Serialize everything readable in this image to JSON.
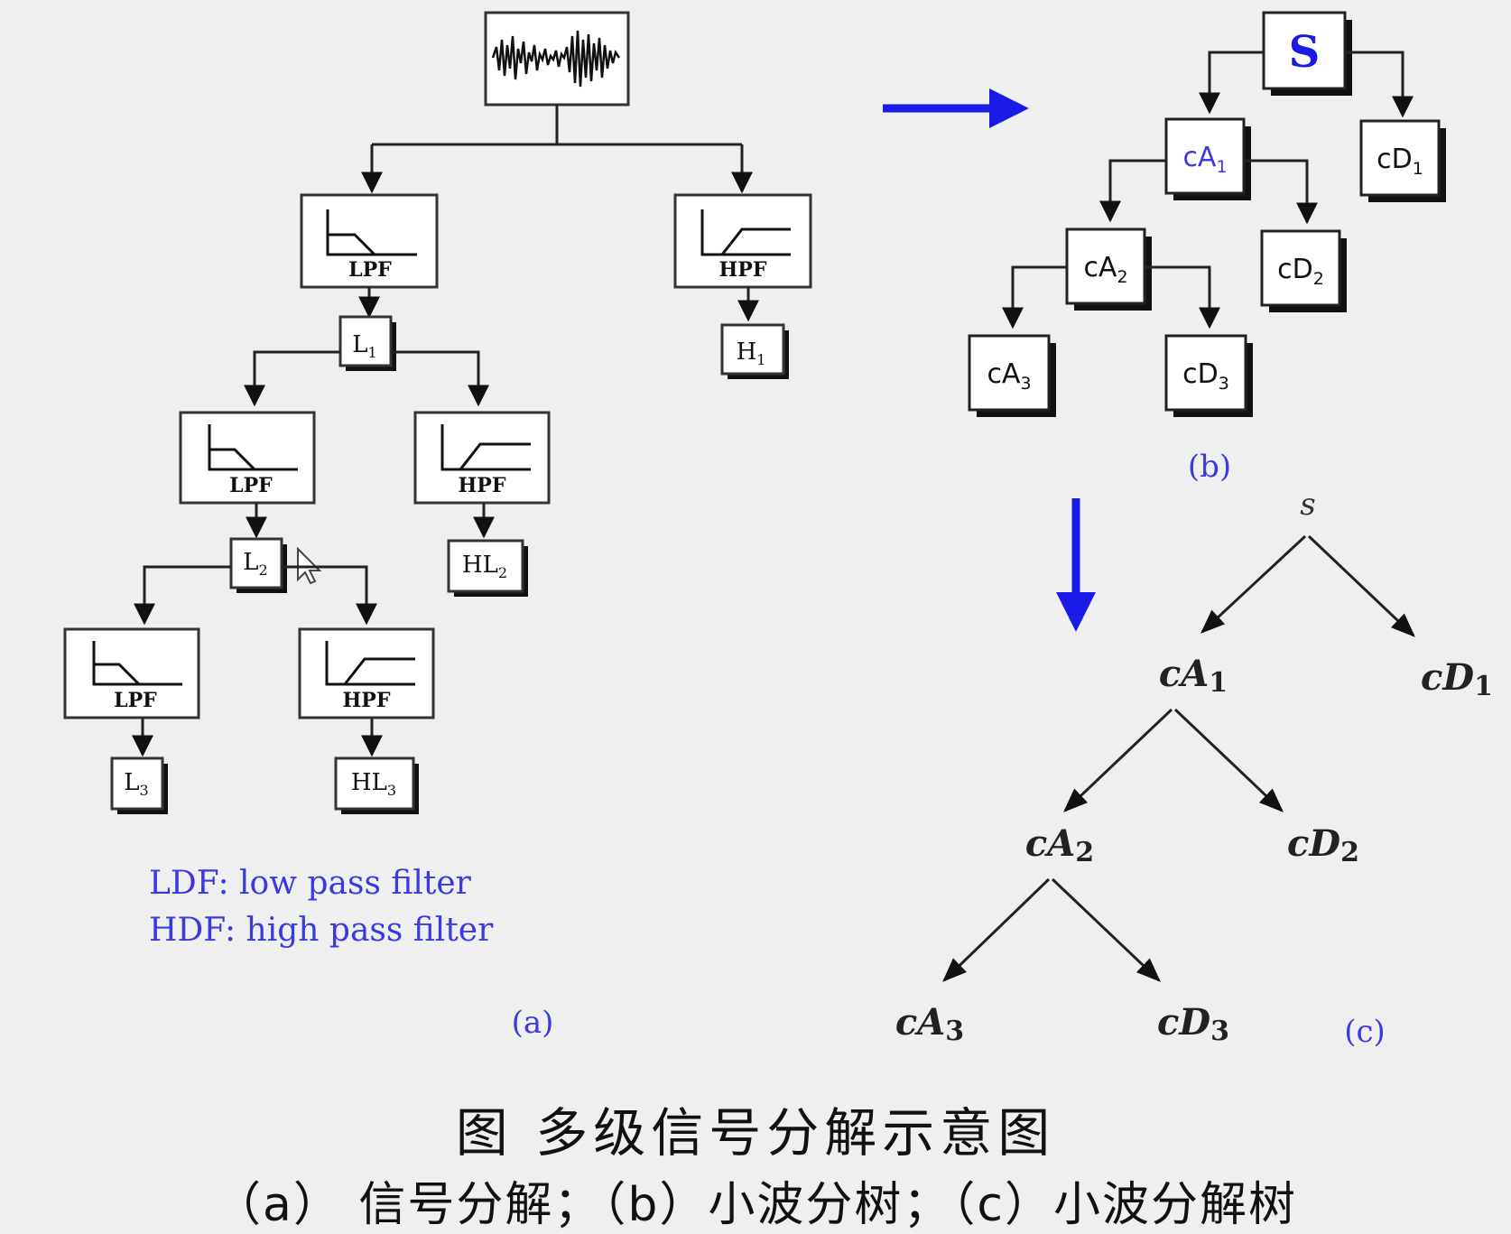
{
  "colors": {
    "accent_blue": "#1a1ae6",
    "label_blue": "#3a3ae0",
    "box_shadow": "#111111"
  },
  "panel_a": {
    "filters": {
      "lpf": "LPF",
      "hpf": "HPF"
    },
    "nodes": {
      "L1": {
        "base": "L",
        "sub": "1"
      },
      "H1": {
        "base": "H",
        "sub": "1"
      },
      "L2": {
        "base": "L",
        "sub": "2"
      },
      "HL2": {
        "base": "HL",
        "sub": "2"
      },
      "L3": {
        "base": "L",
        "sub": "3"
      },
      "HL3": {
        "base": "HL",
        "sub": "3"
      }
    },
    "legend": [
      "LDF: low pass filter",
      "HDF: high pass filter"
    ],
    "label": "(a)"
  },
  "panel_b": {
    "root": "S",
    "nodes": {
      "cA1": {
        "base": "cA",
        "sub": "1"
      },
      "cD1": {
        "base": "cD",
        "sub": "1"
      },
      "cA2": {
        "base": "cA",
        "sub": "2"
      },
      "cD2": {
        "base": "cD",
        "sub": "2"
      },
      "cA3": {
        "base": "cA",
        "sub": "3"
      },
      "cD3": {
        "base": "cD",
        "sub": "3"
      }
    },
    "label": "(b)"
  },
  "panel_c": {
    "root": "s",
    "nodes": {
      "cA1": {
        "base": "cA",
        "sub": "1"
      },
      "cD1": {
        "base": "cD",
        "sub": "1"
      },
      "cA2": {
        "base": "cA",
        "sub": "2"
      },
      "cD2": {
        "base": "cD",
        "sub": "2"
      },
      "cA3": {
        "base": "cA",
        "sub": "3"
      },
      "cD3": {
        "base": "cD",
        "sub": "3"
      }
    },
    "label": "(c)"
  },
  "caption": {
    "title": "图 多级信号分解示意图",
    "subtitle": "（a） 信号分解；（b）小波分树；（c）小波分解树"
  }
}
